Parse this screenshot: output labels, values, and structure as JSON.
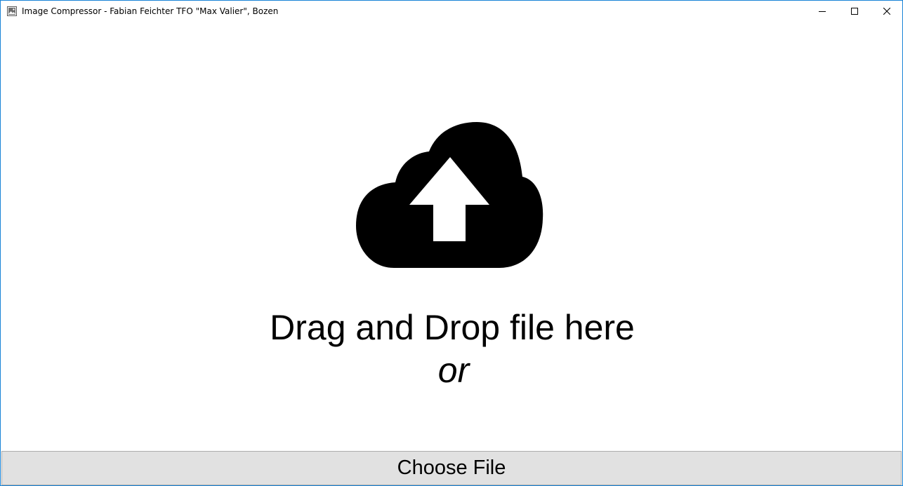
{
  "window": {
    "title": "Image Compressor - Fabian Feichter TFO \"Max Valier\", Bozen",
    "app_icon": "image-icon",
    "controls": {
      "minimize": "minimize-icon",
      "maximize": "maximize-icon",
      "close": "close-icon"
    },
    "border_color": "#1883d7"
  },
  "dropzone": {
    "icon": "cloud-upload-icon",
    "heading": "Drag and Drop file here",
    "separator": "or"
  },
  "choose_button": {
    "label": "Choose File"
  }
}
